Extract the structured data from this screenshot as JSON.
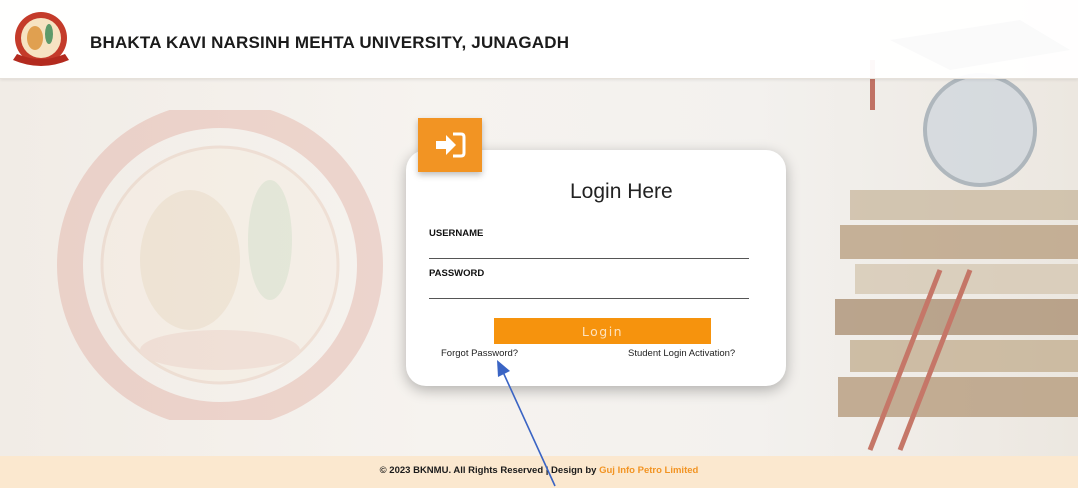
{
  "header": {
    "title": "BHAKTA KAVI NARSINH MEHTA UNIVERSITY, JUNAGADH",
    "logo_icon": "university-seal-logo"
  },
  "login": {
    "badge_icon": "sign-in-icon",
    "title": "Login Here",
    "username_label": "USERNAME",
    "username_value": "",
    "password_label": "PASSWORD",
    "password_value": "",
    "button_label": "Login",
    "forgot_password": "Forgot Password?",
    "student_activation": "Student Login Activation?"
  },
  "footer": {
    "text": "© 2023 BKNMU. All Rights Reserved | Design by ",
    "link": "Guj Info Petro Limited"
  },
  "colors": {
    "accent": "#f29423",
    "footer_bg": "#fbe8cf",
    "annotation_arrow": "#3a64c4"
  }
}
